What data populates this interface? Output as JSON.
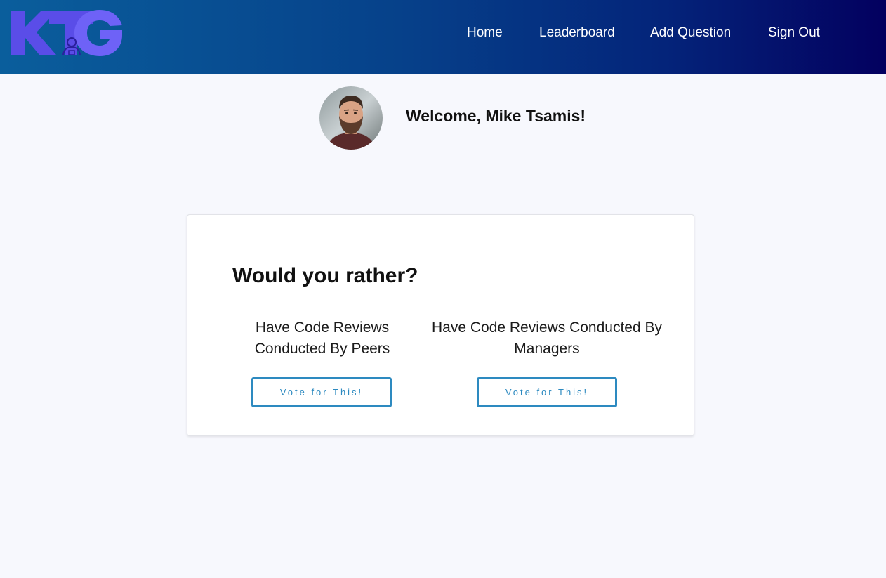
{
  "header": {
    "logo_text": "KTG",
    "nav": [
      {
        "label": "Home"
      },
      {
        "label": "Leaderboard"
      },
      {
        "label": "Add Question"
      },
      {
        "label": "Sign Out"
      }
    ]
  },
  "user": {
    "welcome": "Welcome, Mike Tsamis!"
  },
  "poll": {
    "title": "Would you rather?",
    "options": [
      {
        "text": "Have Code Reviews Conducted By Peers",
        "button": "Vote for This!"
      },
      {
        "text": "Have Code Reviews Conducted By Managers",
        "button": "Vote for This!"
      }
    ]
  },
  "colors": {
    "logo": "#6b5cf4",
    "button_accent": "#2d8ac0",
    "page_background": "#f7f8fd"
  }
}
